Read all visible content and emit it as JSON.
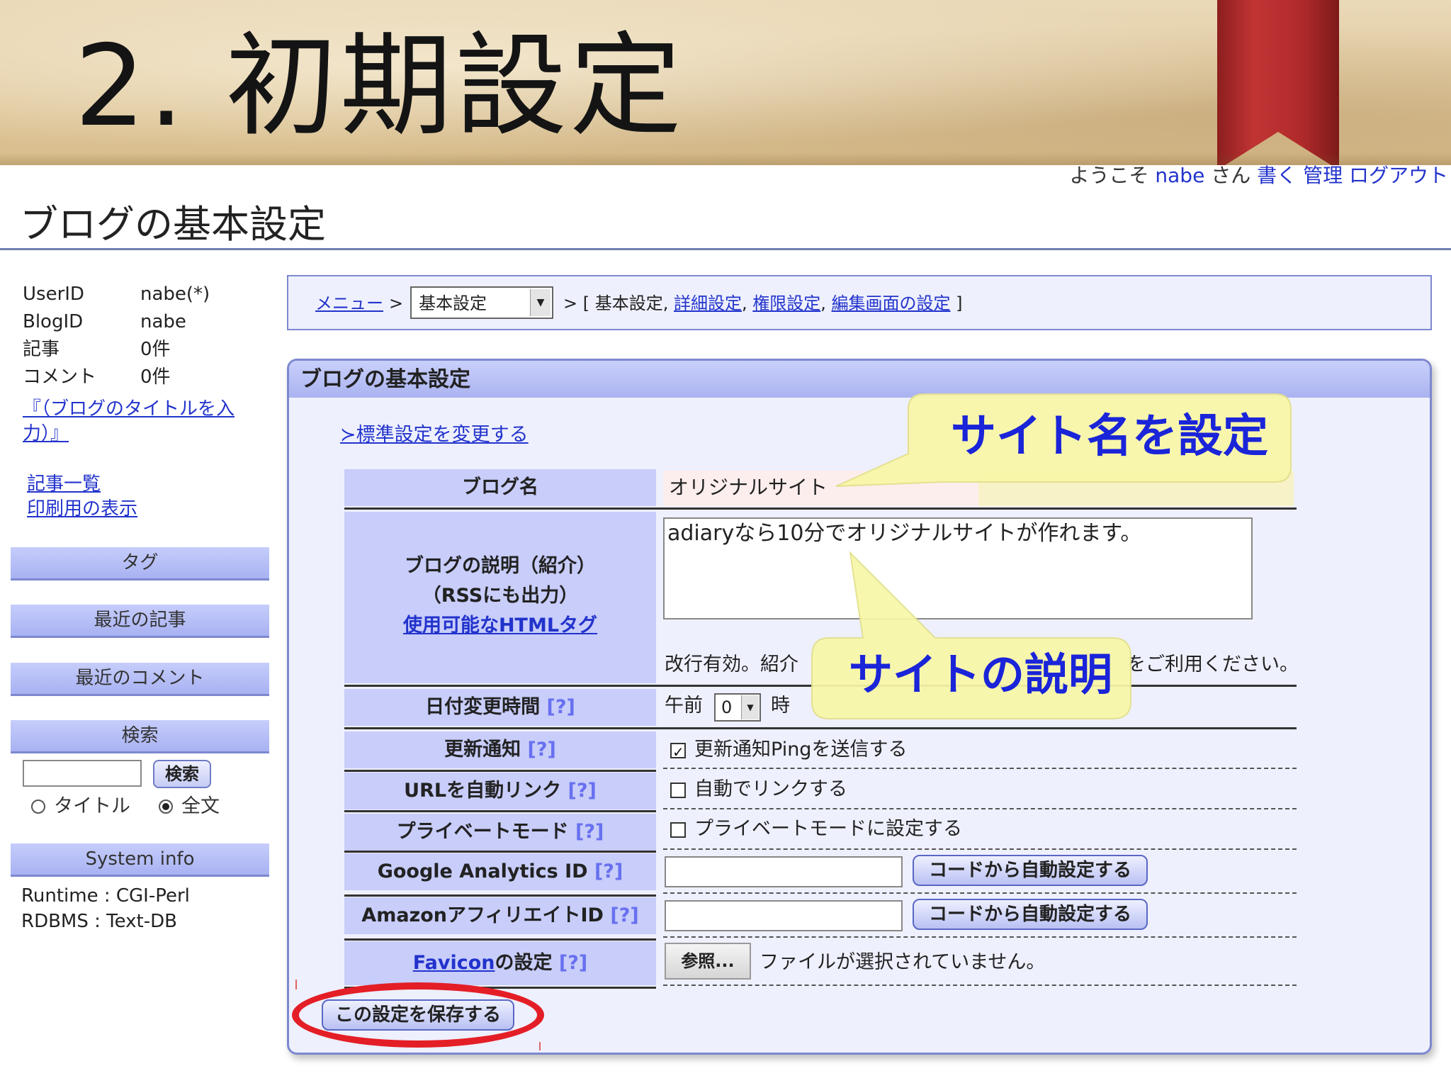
{
  "slide": {
    "title": "2. 初期設定"
  },
  "header": {
    "welcome_prefix": "ようこそ",
    "user": "nabe",
    "san": "さん",
    "links": [
      "書く",
      "管理",
      "ログアウト"
    ]
  },
  "page_heading": "ブログの基本設定",
  "sidebar": {
    "info": [
      {
        "key": "UserID",
        "value": "nabe(*)"
      },
      {
        "key": "BlogID",
        "value": "nabe"
      },
      {
        "key": "記事",
        "value": "0件"
      },
      {
        "key": "コメント",
        "value": "0件"
      }
    ],
    "blog_title_link": "『（ブログのタイトルを入力）』",
    "links": [
      "記事一覧",
      "印刷用の表示"
    ],
    "boxes": [
      "タグ",
      "最近の記事",
      "最近のコメント",
      "検索",
      "System info"
    ],
    "search_button": "検索",
    "search_options": [
      "タイトル",
      "全文"
    ],
    "system_info": [
      "Runtime : CGI-Perl",
      "RDBMS : Text-DB"
    ]
  },
  "breadcrumb": {
    "menu": "メニュー",
    "sep": ">",
    "select_value": "基本設定",
    "trail_prefix": "> [ 基本設定,",
    "trail_links": [
      "詳細設定",
      "権限設定",
      "編集画面の設定"
    ],
    "trail_suffix": "]"
  },
  "panel": {
    "title": "ブログの基本設定",
    "std_link": "≻標準設定を変更する",
    "help": "[?]",
    "rows": {
      "blog_name": {
        "label": "ブログ名",
        "value": "オリジナルサイト"
      },
      "description": {
        "label_line1": "ブログの説明（紹介）",
        "label_line2": "（RSSにも出力）",
        "label_link": "使用可能なHTMLタグ",
        "value": "adiaryなら10分でオリジナルサイトが作れます。",
        "note_start": "改行有効。紹介",
        "note_end": "をご利用ください。"
      },
      "date_change": {
        "label": "日付変更時間",
        "prefix": "午前",
        "hour": "0",
        "suffix": "時"
      },
      "update_notify": {
        "label": "更新通知",
        "option": "更新通知Pingを送信する",
        "checked": true
      },
      "auto_link": {
        "label": "URLを自動リンク",
        "option": "自動でリンクする",
        "checked": false
      },
      "private_mode": {
        "label": "プライベートモード",
        "option": "プライベートモードに設定する",
        "checked": false
      },
      "analytics": {
        "label": "Google Analytics ID",
        "button": "コードから自動設定する"
      },
      "amazon": {
        "label": "AmazonアフィリエイトID",
        "button": "コードから自動設定する"
      },
      "favicon": {
        "label_link": "Favicon",
        "label_rest": "の設定",
        "browse": "参照...",
        "status": "ファイルが選択されていません。"
      }
    },
    "save_button": "この設定を保存する"
  },
  "callouts": {
    "site_name": "サイト名を設定",
    "site_description": "サイトの説明"
  },
  "colors": {
    "accent": "#c8cdfa",
    "link": "#2233cc",
    "callout_text": "#1a24d8",
    "callout_fill": "#f8f7a8",
    "highlight": "#e41e26",
    "ribbon": "#b32a2a"
  }
}
